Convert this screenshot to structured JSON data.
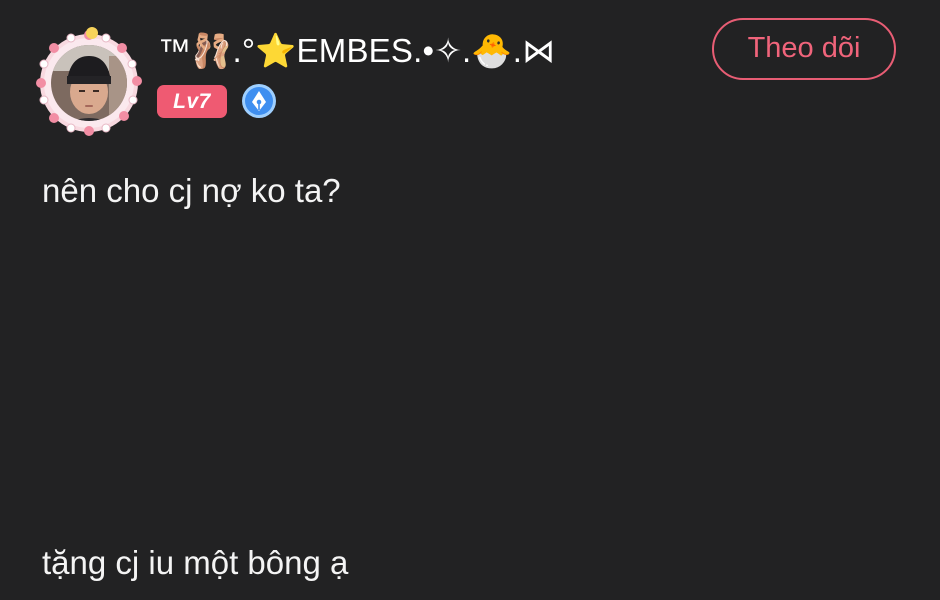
{
  "profile": {
    "username": "™🩰.°⭐EMBES.•✧.🐣.⋈",
    "level": "Lv7",
    "avatar_icon": "user-avatar-with-cute-frame",
    "creator_badge_icon": "pen-nib-badge-icon"
  },
  "follow_button": {
    "label": "Theo dõi"
  },
  "post": {
    "line_1": "nên cho cj nợ ko ta?",
    "line_2": "tặng cj iu một bông ạ"
  },
  "colors": {
    "background": "#222223",
    "accent": "#e85d74",
    "level_badge": "#ef5a72",
    "creator_badge": "#3f8ff0"
  }
}
